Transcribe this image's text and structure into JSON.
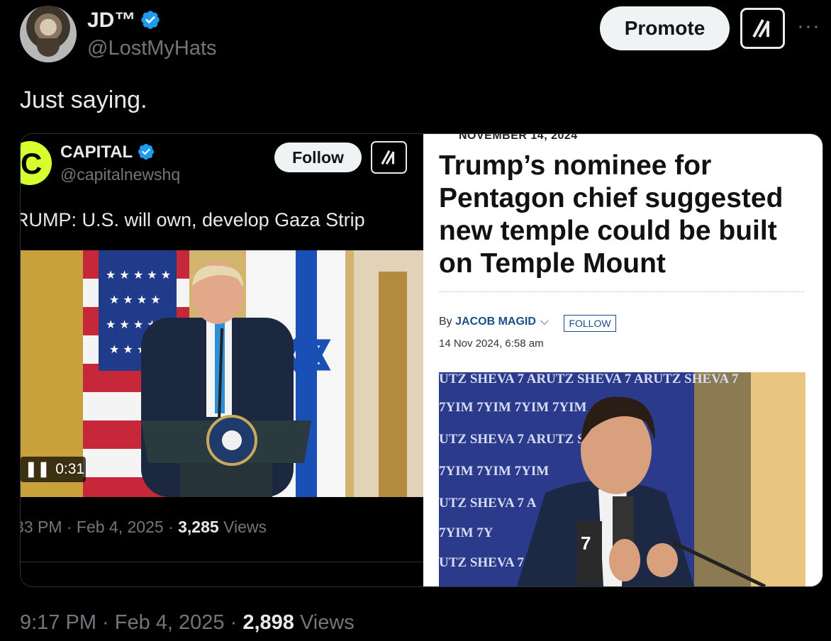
{
  "author": {
    "name": "JD™",
    "handle": "@LostMyHats"
  },
  "header": {
    "promote_label": "Promote",
    "more_label": "···"
  },
  "tweet": {
    "text": "Just saying."
  },
  "quoted_left": {
    "account_name": "CAPITAL",
    "account_handle": "@capitalnewshq",
    "follow_label": "Follow",
    "text": "RUMP: U.S. will own, develop Gaza Strip",
    "video_time": "0:31",
    "meta_time": "33 PM · Feb 4, 2025 · ",
    "meta_views_count": "3,285",
    "meta_views_label": " Views"
  },
  "quoted_right": {
    "date_top": "NOVEMBER 14, 2024",
    "headline": "Trump’s nominee for Pentagon chief suggested new temple could be built on Temple Mount",
    "by_label": "By ",
    "author": "JACOB MAGID",
    "follow_label": "FOLLOW",
    "pub_date": "14 Nov 2024, 6:58 am"
  },
  "footer": {
    "time": "9:17 PM · Feb 4, 2025 · ",
    "views_count": "2,898",
    "views_label": " Views"
  },
  "colors": {
    "verified": "#1d9bf0",
    "background": "#000000",
    "muted": "#71767b",
    "capital_logo": "#d7ff2f"
  },
  "icons": [
    "verified-badge-icon",
    "grok-icon",
    "pause-icon",
    "more-icon"
  ]
}
